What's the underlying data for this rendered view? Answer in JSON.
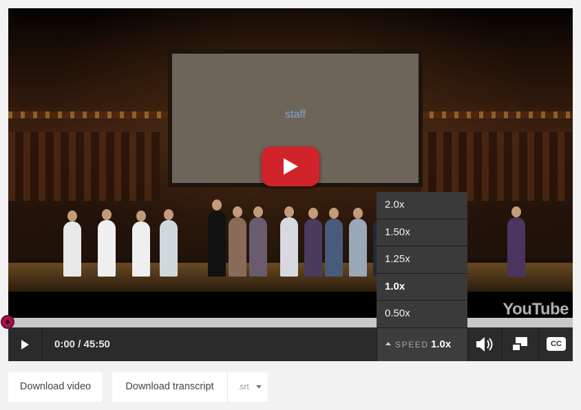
{
  "video": {
    "slide_text": "staff",
    "watermark": "YouTube"
  },
  "progress": {
    "played_fraction": 0.0
  },
  "controls": {
    "time_display": "0:00 / 45:50",
    "speed_label": "SPEED",
    "speed_value": "1.0x",
    "cc_label": "CC"
  },
  "speed_menu": {
    "options": [
      "2.0x",
      "1.50x",
      "1.25x",
      "1.0x",
      "0.50x"
    ],
    "selected": "1.0x"
  },
  "downloads": {
    "video_label": "Download video",
    "transcript_label": "Download transcript",
    "format_selected": ".srt"
  },
  "colors": {
    "accent": "#a3134a",
    "play_button": "#d1232a",
    "controls_bg": "#2b2b2b"
  }
}
